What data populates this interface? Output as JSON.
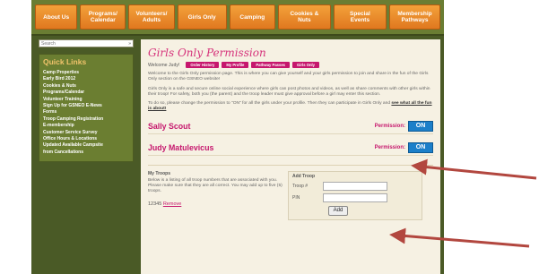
{
  "nav": [
    {
      "label": "About Us"
    },
    {
      "label": "Programs/\nCalendar"
    },
    {
      "label": "Volunteers/\nAdults"
    },
    {
      "label": "Girls Only"
    },
    {
      "label": "Camping"
    },
    {
      "label": "Cookies &\nNuts"
    },
    {
      "label": "Special\nEvents"
    },
    {
      "label": "Membership\nPathways"
    }
  ],
  "search": {
    "value": "Search",
    "go": "»"
  },
  "quick_links": {
    "title": "Quick Links",
    "items": [
      "Camp Properties",
      "Early Bird 2012",
      "Cookies & Nuts",
      "Programs/Calendar",
      "Volunteer Training",
      "Sign Up for GSNEO E-News",
      "Forms",
      "Troop Camping Registration",
      "E-membership",
      "Customer Service Survey",
      "Office Hours & Locations",
      "Updated Available Campsite",
      "from Cancellations"
    ]
  },
  "main": {
    "title": "Girls Only Permission",
    "welcome": "Welcome Judy!",
    "buttons": [
      "Order History",
      "My Profile",
      "Pathway Passes",
      "Girls Only"
    ],
    "para1": "Welcome to the Girls Only permission page. This is where you can give yourself and your girls permission to join and share in the fun of the Girls Only section on the GSNEO website!",
    "para2": "Girls Only is a safe and secure online social experience where girls can post photos and videos, as well as share comments with other girls within their troop! For safety, both you (the parent) and the troop leader must give approval before a girl may enter this section.",
    "para3": "To do so, please change the permission to \"ON\" for all the girls under your profile. Then they can participate in Girls Only and",
    "para3_link": "see what all the fun is about!",
    "people": [
      {
        "name": "Sally Scout",
        "permission_label": "Permission:",
        "status": "ON"
      },
      {
        "name": "Judy Matulevicus",
        "permission_label": "Permission:",
        "status": "ON"
      }
    ],
    "my_troops": {
      "title": "My Troops",
      "text": "Below is a listing of all troop numbers that are associated with you. Please make sure that they are all correct. You may add up to five (5) troops.",
      "troop_number": "12345",
      "remove": "Remove"
    },
    "add_troop": {
      "title": "Add Troop",
      "troop_label": "Troop #",
      "pin_label": "PIN",
      "troop_value": "",
      "pin_value": "",
      "add_label": "Add"
    }
  },
  "colors": {
    "accent_pink": "#c6176d",
    "nav_orange": "#e0781f",
    "toggle_blue": "#1c7fc9",
    "arrow_red": "#b2473f"
  }
}
